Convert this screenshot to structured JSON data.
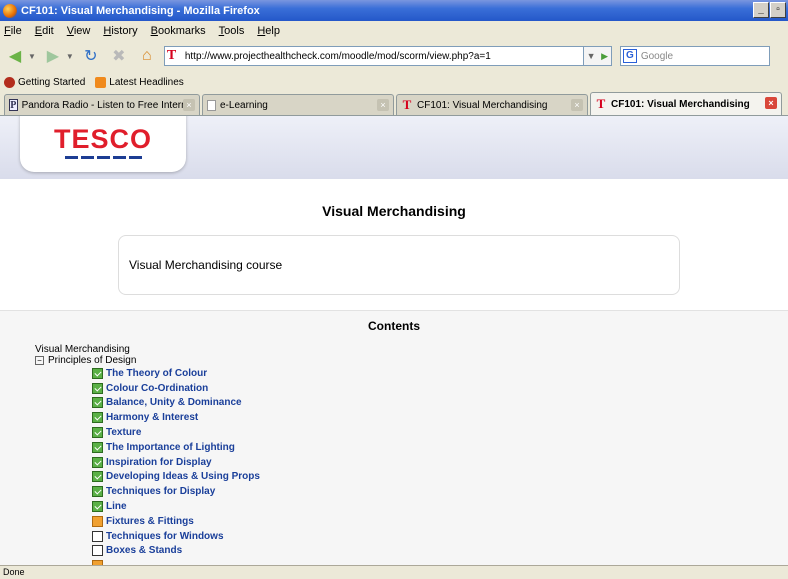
{
  "window": {
    "title": "CF101: Visual Merchandising - Mozilla Firefox"
  },
  "menu": [
    "File",
    "Edit",
    "View",
    "History",
    "Bookmarks",
    "Tools",
    "Help"
  ],
  "navbar": {
    "url": "http://www.projecthealthcheck.com/moodle/mod/scorm/view.php?a=1",
    "search_placeholder": "Google"
  },
  "bookmarks": [
    "Getting Started",
    "Latest Headlines"
  ],
  "tabs": [
    {
      "label": "Pandora Radio - Listen to Free Intern...",
      "icon": "pandora-icon"
    },
    {
      "label": "e-Learning",
      "icon": "page-icon"
    },
    {
      "label": "CF101: Visual Merchandising",
      "icon": "tesco-t-icon"
    },
    {
      "label": "CF101: Visual Merchandising",
      "icon": "tesco-t-icon"
    }
  ],
  "brand": {
    "logo_text": "TESCO",
    "logo_color": "#e01e2b",
    "stripe_color": "#1d3d93"
  },
  "page": {
    "title": "Visual Merchandising",
    "summary": "Visual Merchandising course",
    "contents_heading": "Contents",
    "toc_root": "Visual Merchandising",
    "toc_section": "Principles of Design",
    "toc_items": [
      {
        "label": "The Theory of Colour",
        "status": "completed"
      },
      {
        "label": "Colour Co-Ordination",
        "status": "completed"
      },
      {
        "label": "Balance, Unity & Dominance",
        "status": "completed"
      },
      {
        "label": "Harmony & Interest",
        "status": "completed"
      },
      {
        "label": "Texture",
        "status": "completed"
      },
      {
        "label": "The Importance of Lighting",
        "status": "completed"
      },
      {
        "label": "Inspiration for Display",
        "status": "completed"
      },
      {
        "label": "Developing Ideas & Using Props",
        "status": "completed"
      },
      {
        "label": "Techniques for Display",
        "status": "completed"
      },
      {
        "label": "Line",
        "status": "completed"
      },
      {
        "label": "Fixtures & Fittings",
        "status": "incomplete"
      },
      {
        "label": "Techniques for Windows",
        "status": "notattempted"
      },
      {
        "label": "Boxes & Stands",
        "status": "notattempted"
      },
      {
        "label": "",
        "status": "incomplete"
      }
    ]
  },
  "status": {
    "text": "Done"
  }
}
